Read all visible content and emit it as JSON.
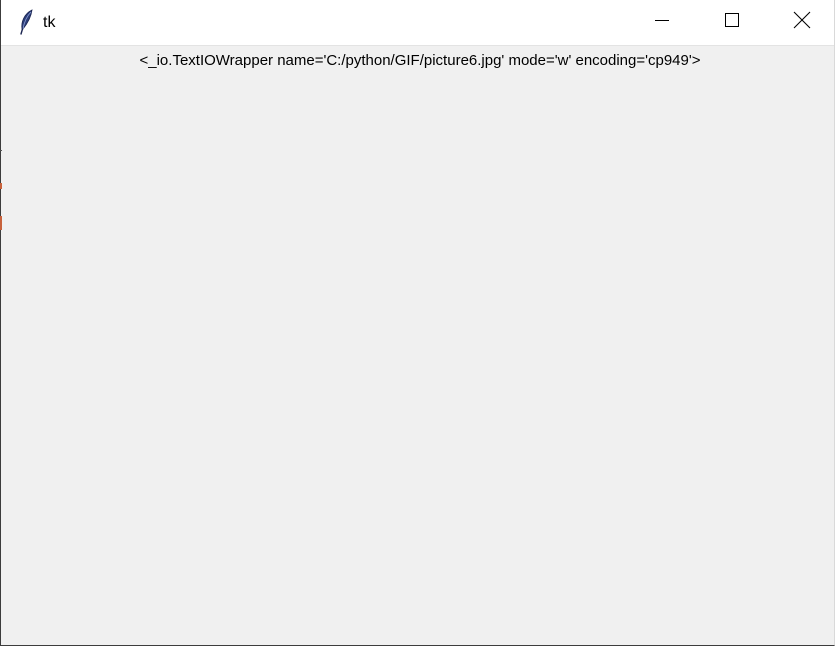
{
  "window": {
    "title": "tk",
    "controls": {
      "minimize": "minimize",
      "maximize": "maximize",
      "close": "close"
    }
  },
  "label": {
    "text": "<_io.TextIOWrapper name='C:/python/GIF/picture6.jpg' mode='w' encoding='cp949'>"
  },
  "colors": {
    "background": "#f0f0f0",
    "titlebar": "#ffffff",
    "text": "#000000"
  },
  "icons": {
    "app": "feather-icon",
    "minimize": "minimize-icon",
    "maximize": "maximize-icon",
    "close": "close-icon"
  }
}
